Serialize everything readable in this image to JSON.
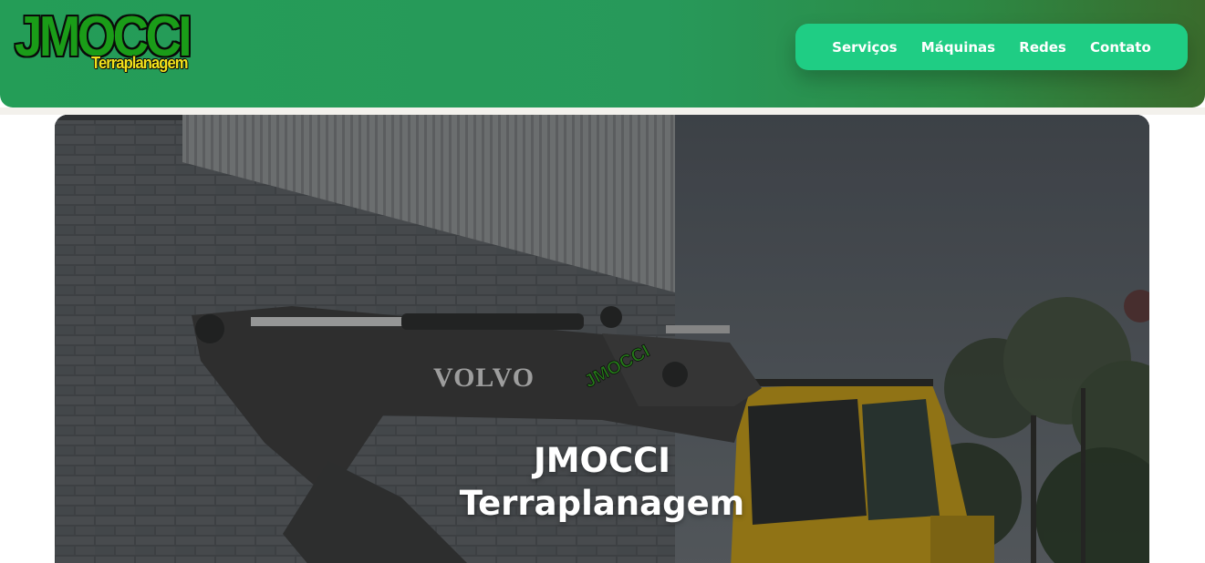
{
  "brand": {
    "logo_main": "JMOCCI",
    "logo_sub": "Terraplanagem"
  },
  "nav": {
    "items": [
      {
        "label": "Serviços"
      },
      {
        "label": "Máquinas"
      },
      {
        "label": "Redes"
      },
      {
        "label": "Contato"
      }
    ]
  },
  "hero": {
    "title_line1": "JMOCCI",
    "title_line2": "Terraplanagem",
    "machine_brand": "VOLVO",
    "machine_sticker": "JMOCCI"
  },
  "colors": {
    "header_green": "#249d57",
    "nav_pill": "#1fcd84",
    "logo_green": "#1a9c18",
    "logo_yellow": "#f2e21b",
    "excavator_yellow": "#b9941c"
  }
}
